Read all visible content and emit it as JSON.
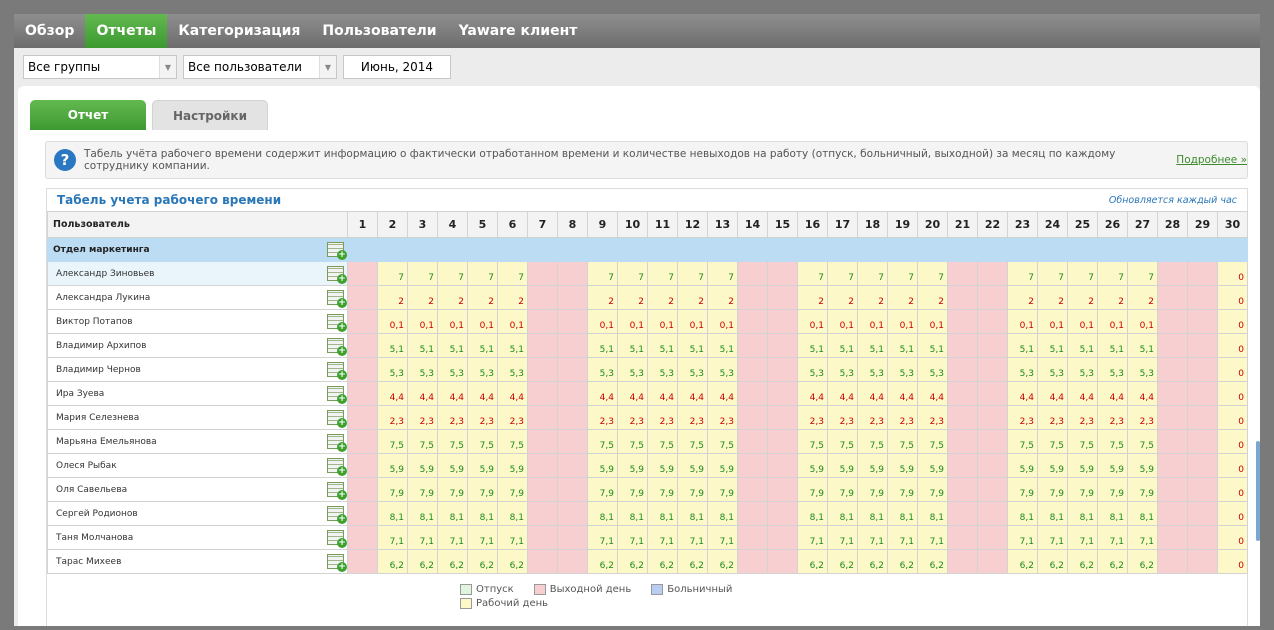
{
  "nav": {
    "items": [
      {
        "label": "Обзор"
      },
      {
        "label": "Отчеты"
      },
      {
        "label": "Категоризация"
      },
      {
        "label": "Пользователи"
      },
      {
        "label": "Yaware клиент"
      }
    ],
    "active_index": 1
  },
  "filters": {
    "group": "Все группы",
    "user": "Все пользователи",
    "month": "Июнь, 2014"
  },
  "tabs": {
    "report": "Отчет",
    "settings": "Настройки"
  },
  "info": {
    "text": "Табель учёта рабочего времени содержит информацию о фактически отработанном времени и количестве невыходов на работу (отпуск, больничный, выходной) за месяц по каждому сотруднику компании.",
    "link": "Подробнее »"
  },
  "section": {
    "title": "Табель учета рабочего времени",
    "note": "Обновляется каждый час"
  },
  "table": {
    "user_header": "Пользователь",
    "days": [
      "1",
      "2",
      "3",
      "4",
      "5",
      "6",
      "7",
      "8",
      "9",
      "10",
      "11",
      "12",
      "13",
      "14",
      "15",
      "16",
      "17",
      "18",
      "19",
      "20",
      "21",
      "22",
      "23",
      "24",
      "25",
      "26",
      "27",
      "28",
      "29",
      "30"
    ],
    "off_days": [
      1,
      7,
      8,
      14,
      15,
      21,
      22,
      28,
      29
    ],
    "department": "Отдел маркетинга",
    "users": [
      {
        "name": "Александр Зиновьев",
        "value": "7",
        "color": "#1c8a1c",
        "last": "0"
      },
      {
        "name": "Александра Лукина",
        "value": "2",
        "color": "#cc0000",
        "last": "0"
      },
      {
        "name": "Виктор Потапов",
        "value": "0,1",
        "color": "#cc0000",
        "last": "0"
      },
      {
        "name": "Владимир Архипов",
        "value": "5,1",
        "color": "#1c8a1c",
        "last": "0"
      },
      {
        "name": "Владимир Чернов",
        "value": "5,3",
        "color": "#1c8a1c",
        "last": "0"
      },
      {
        "name": "Ира Зуева",
        "value": "4,4",
        "color": "#cc0000",
        "last": "0"
      },
      {
        "name": "Мария Селезнева",
        "value": "2,3",
        "color": "#cc0000",
        "last": "0"
      },
      {
        "name": "Марьяна Емельянова",
        "value": "7,5",
        "color": "#1c8a1c",
        "last": "0"
      },
      {
        "name": "Олеся Рыбак",
        "value": "5,9",
        "color": "#1c8a1c",
        "last": "0"
      },
      {
        "name": "Оля Савельева",
        "value": "7,9",
        "color": "#1c8a1c",
        "last": "0"
      },
      {
        "name": "Сергей Родионов",
        "value": "8,1",
        "color": "#1c8a1c",
        "last": "0"
      },
      {
        "name": "Таня Молчанова",
        "value": "7,1",
        "color": "#1c8a1c",
        "last": "0"
      },
      {
        "name": "Тарас Михеев",
        "value": "6,2",
        "color": "#1c8a1c",
        "last": "0"
      }
    ]
  },
  "legend": {
    "vacation": {
      "label": "Отпуск",
      "color": "#dff5df"
    },
    "day_off": {
      "label": "Выходной день",
      "color": "#f8cfd0"
    },
    "sick": {
      "label": "Больничный",
      "color": "#b8cdf0"
    },
    "work_day": {
      "label": "Рабочий день",
      "color": "#fdf8c8"
    }
  }
}
